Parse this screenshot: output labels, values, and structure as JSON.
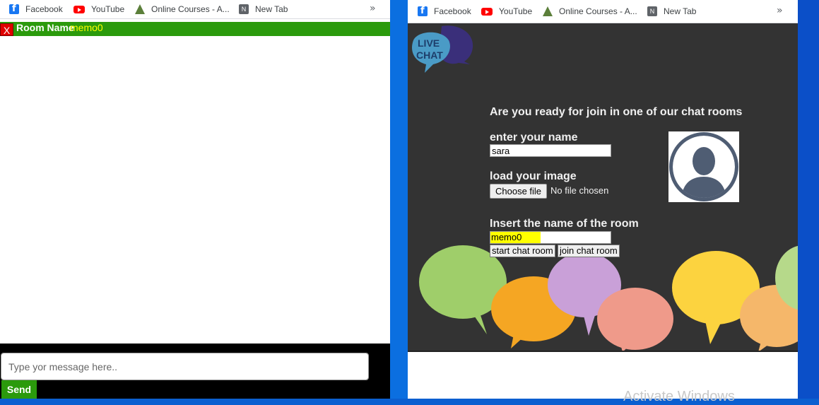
{
  "bookmarks": [
    {
      "label": "Facebook",
      "icon": "facebook-icon"
    },
    {
      "label": "YouTube",
      "icon": "youtube-icon"
    },
    {
      "label": "Online Courses - A...",
      "icon": "online-courses-icon"
    },
    {
      "label": "New Tab",
      "icon": "new-tab-icon"
    }
  ],
  "bookmarks_more": "»",
  "left": {
    "close_label": "X",
    "room_label": "Room Name",
    "room_value": "memo0",
    "message_placeholder": "Type yor message here..",
    "send_label": "Send"
  },
  "right": {
    "logo_line1": "LIVE",
    "logo_line2": "CHAT",
    "heading": "Are you ready for join in one of our chat rooms",
    "name_label": "enter your name",
    "name_value": "sara",
    "image_label": "load your image",
    "choose_file_label": "Choose file",
    "file_status": "No file chosen",
    "room_label": "Insert the name of the room",
    "room_value": "memo0",
    "start_button": "start chat room",
    "join_button": "join chat room",
    "watermark": "Activate Windows"
  },
  "colors": {
    "room_bar": "#2b9a0c",
    "room_value": "#ffff00",
    "close_button": "#e00000",
    "stage_bg": "#333333",
    "taskbar_blue": "#0b5fd0"
  }
}
